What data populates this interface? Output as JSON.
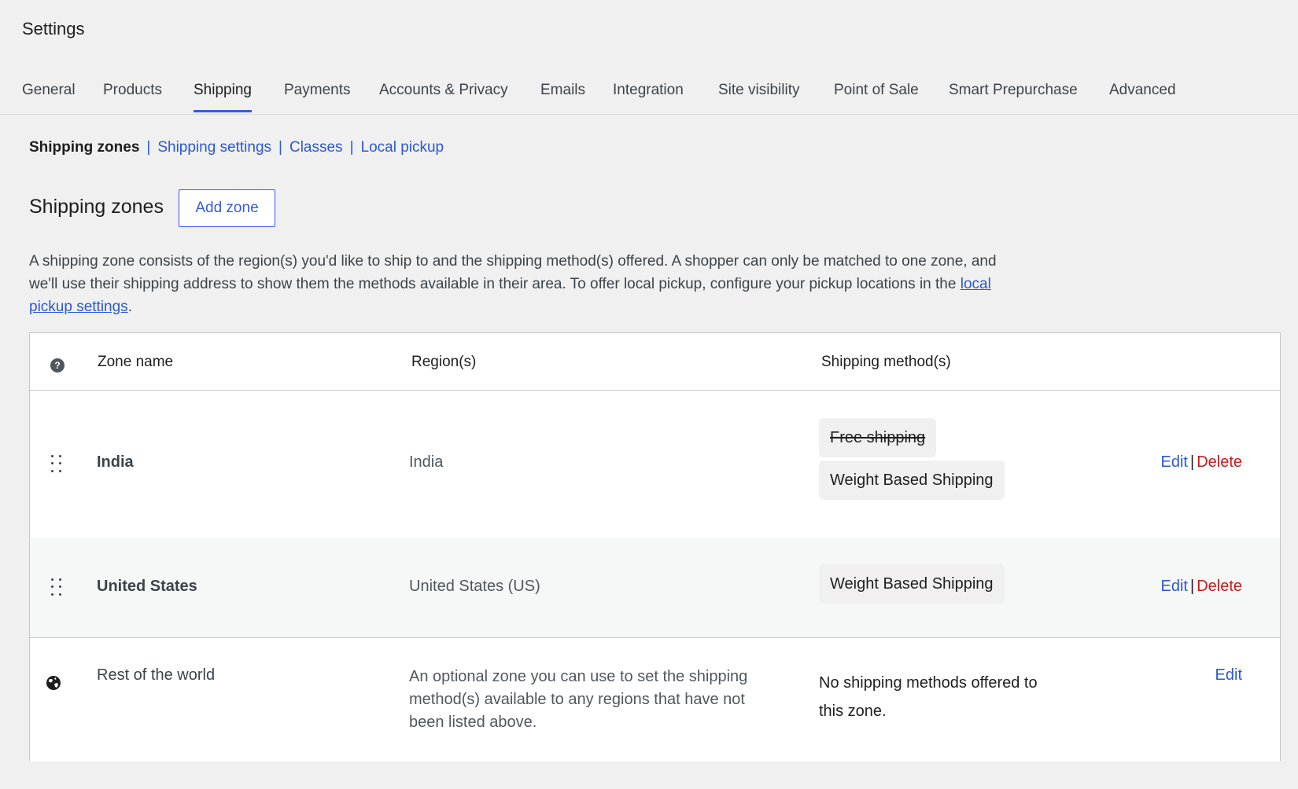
{
  "page": {
    "title": "Settings"
  },
  "tabs": [
    {
      "label": "General"
    },
    {
      "label": "Products"
    },
    {
      "label": "Shipping",
      "active": true
    },
    {
      "label": "Payments"
    },
    {
      "label": "Accounts & Privacy"
    },
    {
      "label": "Emails"
    },
    {
      "label": "Integration"
    },
    {
      "label": "Site visibility"
    },
    {
      "label": "Point of Sale"
    },
    {
      "label": "Smart Prepurchase"
    },
    {
      "label": "Advanced"
    }
  ],
  "subnav": {
    "current": "Shipping zones",
    "links": [
      {
        "label": "Shipping settings"
      },
      {
        "label": "Classes"
      },
      {
        "label": "Local pickup"
      }
    ],
    "separator": "|"
  },
  "zones": {
    "heading": "Shipping zones",
    "add_button": "Add zone",
    "description_before": "A shipping zone consists of the region(s) you'd like to ship to and the shipping method(s) offered. A shopper can only be matched to one zone, and we'll use their shipping address to show them the methods available in their area. To offer local pickup, configure your pickup locations in the ",
    "description_link": "local pickup settings",
    "description_after": "."
  },
  "table": {
    "help_glyph": "?",
    "headers": {
      "zone_name": "Zone name",
      "regions": "Region(s)",
      "methods": "Shipping method(s)"
    },
    "rows": [
      {
        "zone_name": "India",
        "region": "India",
        "methods": [
          {
            "label": "Free shipping",
            "enabled": false
          },
          {
            "label": "Weight Based Shipping",
            "enabled": true
          }
        ],
        "edit": "Edit",
        "delete": "Delete"
      },
      {
        "zone_name": "United States",
        "region": "United States (US)",
        "methods": [
          {
            "label": "Weight Based Shipping",
            "enabled": true
          }
        ],
        "edit": "Edit",
        "delete": "Delete"
      }
    ],
    "rest_of_world": {
      "zone_name": "Rest of the world",
      "description": "An optional zone you can use to set the shipping method(s) available to any regions that have not been listed above.",
      "methods_text": "No shipping methods offered to this zone.",
      "edit": "Edit"
    },
    "action_separator": "|"
  },
  "colors": {
    "accent": "#3858e9",
    "link": "#2b58d6",
    "delete": "#cc1818",
    "background": "#f0f0f0"
  },
  "icons": {
    "help": "help-icon",
    "drag": "drag-handle-icon",
    "globe": "globe-icon"
  }
}
